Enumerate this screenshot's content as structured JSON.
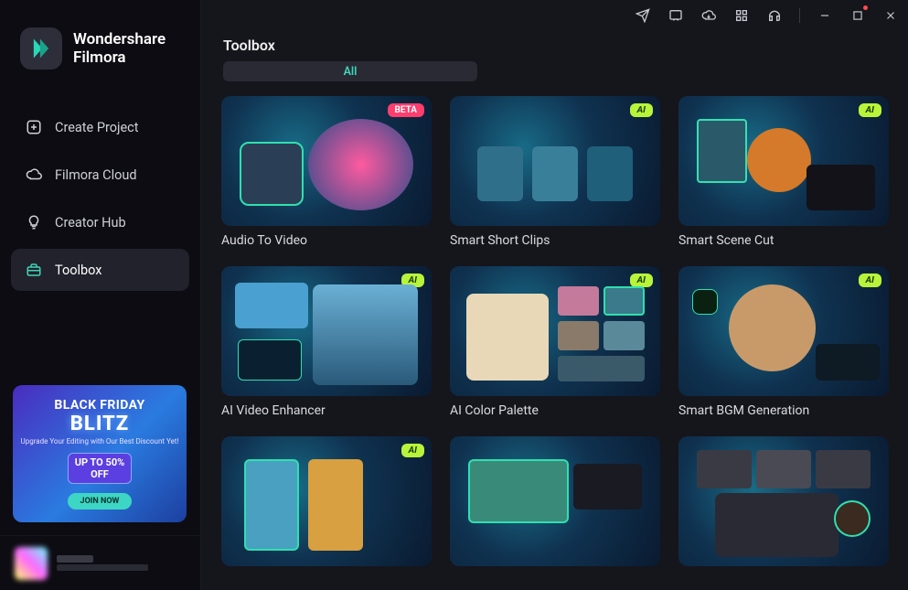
{
  "app": {
    "brand_line1": "Wondershare",
    "brand_line2": "Filmora"
  },
  "sidebar": {
    "items": [
      {
        "label": "Create Project",
        "icon": "plus-square-icon",
        "active": false
      },
      {
        "label": "Filmora Cloud",
        "icon": "cloud-icon",
        "active": false
      },
      {
        "label": "Creator Hub",
        "icon": "bulb-icon",
        "active": false
      },
      {
        "label": "Toolbox",
        "icon": "toolbox-icon",
        "active": true
      }
    ]
  },
  "promo": {
    "line1": "BLACK FRIDAY",
    "line2": "BLITZ",
    "sub": "Upgrade Your Editing with Our Best Discount Yet!",
    "discount_label": "UP TO 50% OFF",
    "cta": "JOIN NOW"
  },
  "titlebar": {
    "icons": [
      "send-icon",
      "feedback-icon",
      "cloud-download-icon",
      "apps-grid-icon",
      "headset-icon",
      "minimize-icon",
      "maximize-icon",
      "close-icon"
    ]
  },
  "page": {
    "title": "Toolbox",
    "tab_all": "All"
  },
  "cards": [
    {
      "label": "Audio To Video",
      "badge": "BETA"
    },
    {
      "label": "Smart Short Clips",
      "badge": "AI"
    },
    {
      "label": "Smart Scene Cut",
      "badge": "AI"
    },
    {
      "label": "AI Video Enhancer",
      "badge": "AI"
    },
    {
      "label": "AI Color Palette",
      "badge": "AI"
    },
    {
      "label": "Smart BGM Generation",
      "badge": "AI"
    },
    {
      "label": "",
      "badge": "AI"
    },
    {
      "label": "",
      "badge": ""
    },
    {
      "label": "",
      "badge": ""
    }
  ]
}
